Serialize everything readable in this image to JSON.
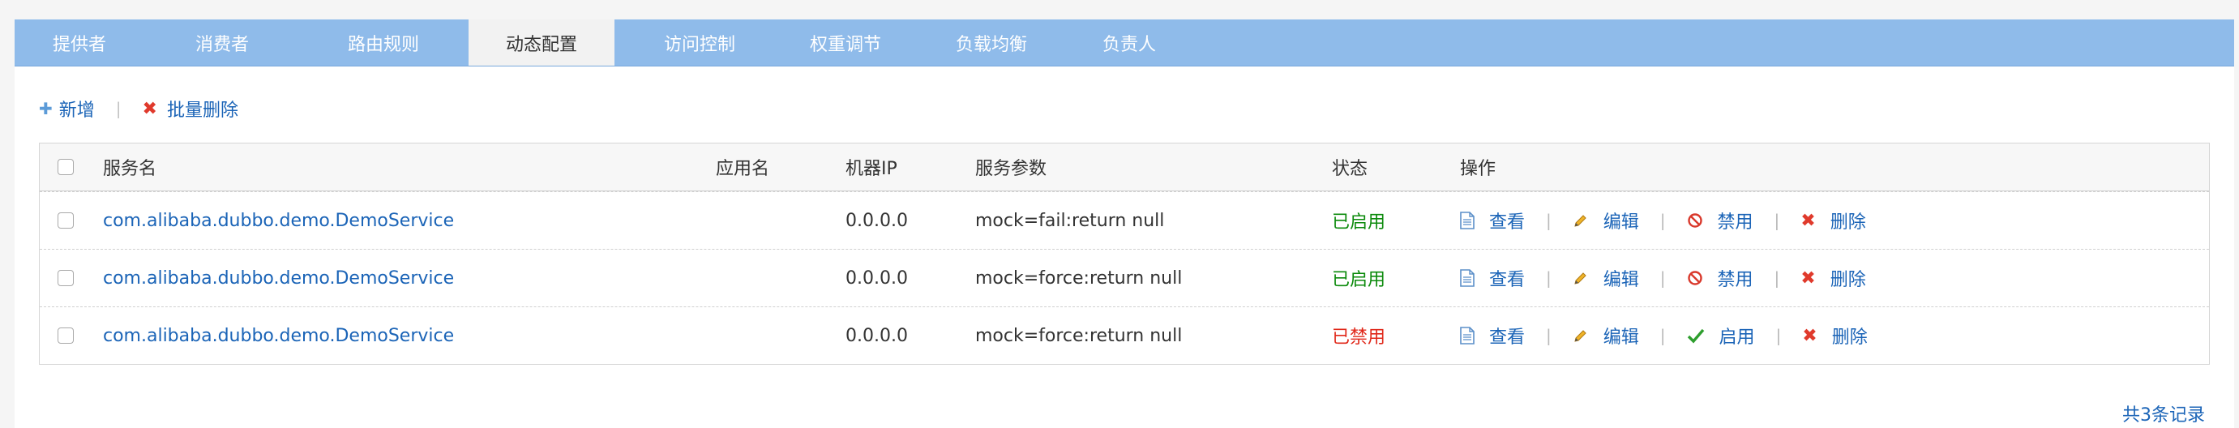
{
  "tabs": [
    {
      "label": "提供者",
      "active": false
    },
    {
      "label": "消费者",
      "active": false
    },
    {
      "label": "路由规则",
      "active": false
    },
    {
      "label": "动态配置",
      "active": true
    },
    {
      "label": "访问控制",
      "active": false
    },
    {
      "label": "权重调节",
      "active": false
    },
    {
      "label": "负载均衡",
      "active": false
    },
    {
      "label": "负责人",
      "active": false
    }
  ],
  "toolbar": {
    "add_label": "新增",
    "separator": "|",
    "batch_delete_label": "批量删除"
  },
  "table": {
    "headers": {
      "service": "服务名",
      "app": "应用名",
      "ip": "机器IP",
      "params": "服务参数",
      "status": "状态",
      "actions": "操作"
    },
    "rows": [
      {
        "service": "com.alibaba.dubbo.demo.DemoService",
        "app": "",
        "ip": "0.0.0.0",
        "params": "mock=fail:return null",
        "status": "已启用",
        "status_enabled": true,
        "view": "查看",
        "edit": "编辑",
        "toggle": "禁用",
        "delete": "删除"
      },
      {
        "service": "com.alibaba.dubbo.demo.DemoService",
        "app": "",
        "ip": "0.0.0.0",
        "params": "mock=force:return null",
        "status": "已启用",
        "status_enabled": true,
        "view": "查看",
        "edit": "编辑",
        "toggle": "禁用",
        "delete": "删除"
      },
      {
        "service": "com.alibaba.dubbo.demo.DemoService",
        "app": "",
        "ip": "0.0.0.0",
        "params": "mock=force:return null",
        "status": "已禁用",
        "status_enabled": false,
        "view": "查看",
        "edit": "编辑",
        "toggle": "启用",
        "delete": "删除"
      }
    ],
    "action_separator": "|"
  },
  "footer": {
    "total": "共3条记录"
  },
  "colors": {
    "tabbar": "#8fbbea",
    "link": "#1b64b7",
    "enabled": "#0b8a0b",
    "disabled": "#e0281a",
    "delete_icon": "#e03a2c"
  },
  "icons": {
    "add": "plus-icon",
    "batch_delete": "x-icon",
    "view": "document-icon",
    "edit": "pencil-icon",
    "disable": "ban-icon",
    "enable": "check-icon",
    "delete": "x-icon"
  }
}
